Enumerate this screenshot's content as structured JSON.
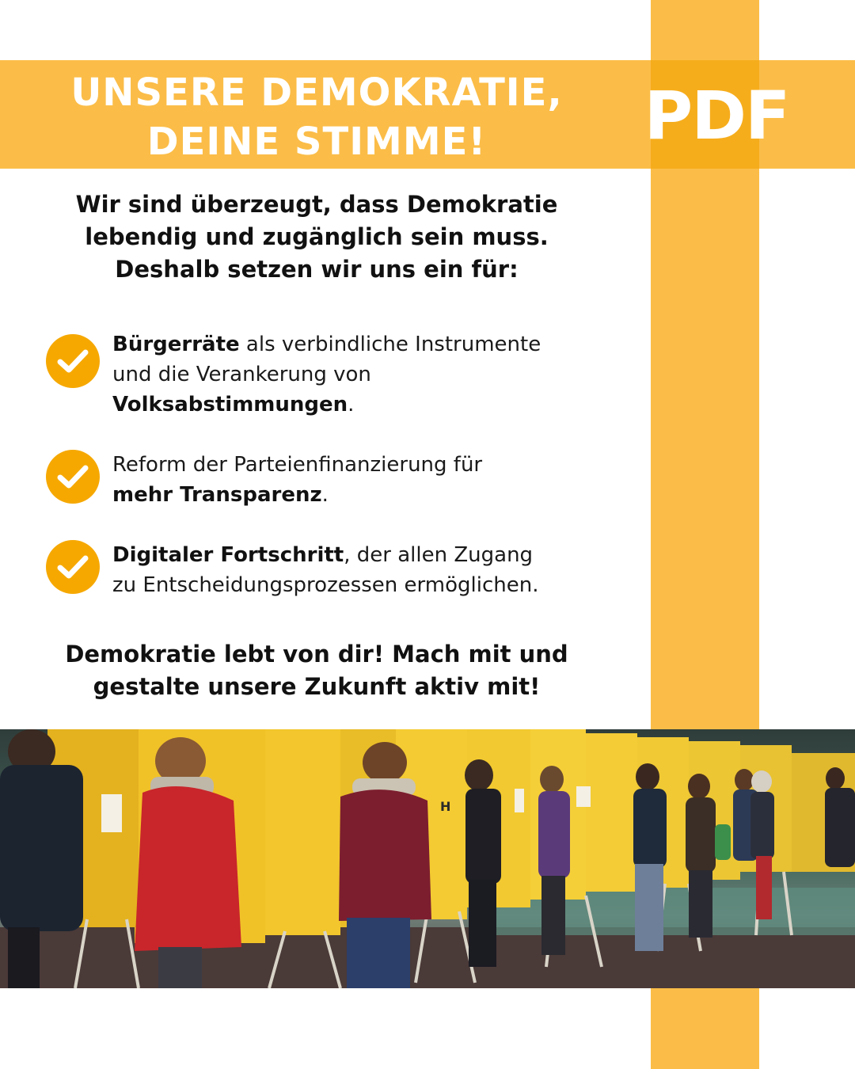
{
  "banner": {
    "headline_line1": "UNSERE DEMOKRATIE,",
    "headline_line2": "DEINE STIMME!",
    "logo_text": "PDF"
  },
  "intro": {
    "line1": "Wir sind überzeugt, dass Demokratie",
    "line2": "lebendig und zugänglich sein muss.",
    "line3": "Deshalb setzen wir uns ein für:"
  },
  "benefits": [
    {
      "bold1": "Bürgerräte",
      "text1": " als verbindliche Instrumente",
      "text2": "und die Verankerung von",
      "bold2": "Volksabstimmungen",
      "end": "."
    },
    {
      "text1": "Reform der Parteienfinanzierung für",
      "bold1": "mehr Transparenz",
      "end": "."
    },
    {
      "bold1": "Digitaler Fortschritt",
      "text1": ", der allen Zugang",
      "text2": "zu Entscheidungsprozessen ermöglichen."
    }
  ],
  "outro": {
    "line1": "Demokratie lebt von dir! Mach mit und",
    "line2": "gestalte unsere Zukunft aktiv mit!"
  },
  "photo": {
    "booth_marker": "H"
  },
  "colors": {
    "stripe": "#fbbd48",
    "stripe_overlap": "#f6ad1c",
    "check": "#f6a800",
    "text": "#111111"
  },
  "icons": [
    "check-circle-icon"
  ]
}
